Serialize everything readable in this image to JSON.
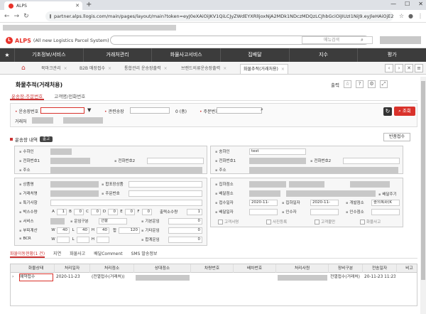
{
  "browser": {
    "tab_title": "ALPS",
    "url": "partner.alps.llogis.com/main/pages/layout/main?token=eyJ0eXAiOiJKV1QiLCJyZWdEYXRlIjoxNjA2MDk1NDczMDQzLCJhbGciOiJIUzI1NiJ9.eyJleHAiOjE2MDY..."
  },
  "app": {
    "brand": "ALPS",
    "brand_sub": "(All new Logistics Parcel System)",
    "menu_search_placeholder": "메뉴검색"
  },
  "menu": [
    "기초정보/서비스",
    "거래처관리",
    "화물사고서비스",
    "집배달",
    "지수",
    "평가"
  ],
  "page_tabs": [
    {
      "label": "북마크관리"
    },
    {
      "label": "B2B 매장접수"
    },
    {
      "label": "통합관리 운송장출력"
    },
    {
      "label": "브랜드의류운송장출력"
    },
    {
      "label": "화물추적(거래처용)"
    }
  ],
  "title": "화물추적(거래처용)",
  "title_actions": {
    "print": "출력"
  },
  "sub_tabs": [
    "운송장-주문번호",
    "고객명/전화번호"
  ],
  "search": {
    "waybill_label": "운송장번호",
    "related_label": "관련송장",
    "count": "0 (총)",
    "order_label": "주문번호",
    "client_label": "거래처",
    "submit": "조회"
  },
  "section": {
    "title": "운송장 내역",
    "badge": "출고",
    "receive_button": "반품접수"
  },
  "sender": {
    "name_label": "수하인",
    "phone1_label": "전화번호1",
    "phone2_label": "전화번호2",
    "address_label": "주소"
  },
  "receiver": {
    "name_label": "송하인",
    "name_value": "test",
    "phone1_label": "전화번호1",
    "phone2_label": "전화번호2",
    "address_label": "주소"
  },
  "goods": {
    "product_label": "상품명",
    "price_label": "합포장상품",
    "client_waybill_label": "거래처명",
    "order_label": "주문번호",
    "special_label": "특기사항",
    "box_label": "박스수량",
    "box_cells": [
      "A",
      "1",
      "B",
      "0",
      "C",
      "0",
      "D",
      "0",
      "E",
      "0",
      "F",
      "0"
    ],
    "box_extra_label": "출력소수량",
    "box_extra_value": "1",
    "service_label": "서비스",
    "fare_label": "운임구분",
    "fare_value": "현불",
    "base_fare_label": "기본운임",
    "base_fare_value": "0",
    "vol_label": "부피계산",
    "vol_cells": [
      "W",
      "40",
      "L",
      "40",
      "H",
      "40"
    ],
    "total_label": "합",
    "total_value": "120",
    "extra_label": "기타운임",
    "extra_value": "0",
    "bcr_label": "BCR",
    "bcr_cells": [
      "W",
      "",
      "L",
      "",
      "H",
      ""
    ],
    "sum_label": "합계운임",
    "sum_value": "0"
  },
  "delivery": {
    "pickup_office_label": "집하점소",
    "delivery_office_label": "배달점소",
    "delivery_shipper_label": "배달주기",
    "receipt_date_label": "접수일자",
    "receipt_date": "2020-11-",
    "pickup_date_label": "집하일자",
    "pickup_date": "2020-11-",
    "planned_label": "개발점소",
    "planned_value": "충의록화(K",
    "delivery_date_label": "배달일자",
    "deliverer_label": "인수자",
    "signer_label": "인수점소",
    "checks": [
      "고객서명",
      "사진등록",
      "고객불만",
      "화물사고"
    ]
  },
  "bottom_tabs": [
    "화물이동현황(1 건)",
    "지연",
    "화물사고",
    "배달Comment",
    "SMS 발송정보"
  ],
  "grid": {
    "columns": [
      "화물상태",
      "처리일자",
      "처리점소",
      "상대점소",
      "차량번호",
      "배차번호",
      "처리사원",
      "장비구분",
      "전송일자",
      "비고"
    ],
    "rows": [
      [
        "예약접수",
        "2020-11-23",
        "(전열접수(거래처))",
        "",
        "",
        "",
        "",
        "전열접수(거래처)",
        "20-11-23 11:23",
        ""
      ]
    ]
  }
}
